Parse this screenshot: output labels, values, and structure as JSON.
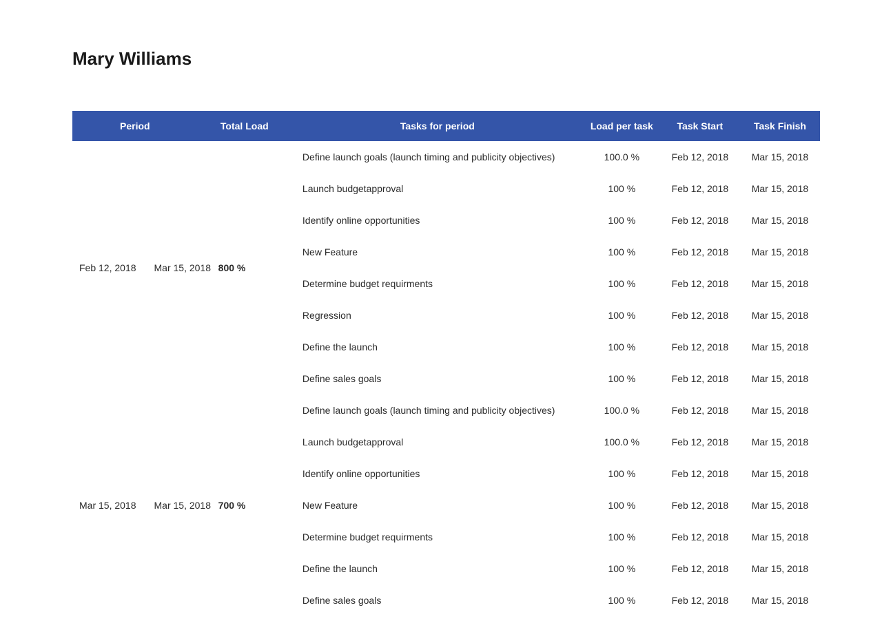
{
  "title": "Mary Williams",
  "headers": {
    "period": "Period",
    "total_load": "Total Load",
    "tasks": "Tasks for period",
    "load_per_task": "Load per task",
    "task_start": "Task Start",
    "task_finish": "Task Finish"
  },
  "periods": [
    {
      "start": "Feb 12, 2018",
      "end": "Mar 15, 2018",
      "total_load": "800 %",
      "tasks": [
        {
          "name": "Define launch goals (launch timing and publicity objectives)",
          "load": "100.0 %",
          "start": "Feb 12, 2018",
          "finish": "Mar 15, 2018"
        },
        {
          "name": "Launch budgetapproval",
          "load": "100 %",
          "start": "Feb 12, 2018",
          "finish": "Mar 15, 2018"
        },
        {
          "name": "Identify online opportunities",
          "load": "100 %",
          "start": "Feb 12, 2018",
          "finish": "Mar 15, 2018"
        },
        {
          "name": "New Feature",
          "load": "100 %",
          "start": "Feb 12, 2018",
          "finish": "Mar 15, 2018"
        },
        {
          "name": "Determine budget requirments",
          "load": "100 %",
          "start": "Feb 12, 2018",
          "finish": "Mar 15, 2018"
        },
        {
          "name": "Regression",
          "load": "100 %",
          "start": "Feb 12, 2018",
          "finish": "Mar 15, 2018"
        },
        {
          "name": "Define the launch",
          "load": "100 %",
          "start": "Feb 12, 2018",
          "finish": "Mar 15, 2018"
        },
        {
          "name": "Define sales goals",
          "load": "100 %",
          "start": "Feb 12, 2018",
          "finish": "Mar 15, 2018"
        }
      ]
    },
    {
      "start": "Mar 15, 2018",
      "end": "Mar 15, 2018",
      "total_load": "700 %",
      "tasks": [
        {
          "name": "Define launch goals (launch timing and publicity objectives)",
          "load": "100.0 %",
          "start": "Feb 12, 2018",
          "finish": "Mar 15, 2018"
        },
        {
          "name": "Launch budgetapproval",
          "load": "100.0 %",
          "start": "Feb 12, 2018",
          "finish": "Mar 15, 2018"
        },
        {
          "name": "Identify online opportunities",
          "load": "100 %",
          "start": "Feb 12, 2018",
          "finish": "Mar 15, 2018"
        },
        {
          "name": "New Feature",
          "load": "100 %",
          "start": "Feb 12, 2018",
          "finish": "Mar 15, 2018"
        },
        {
          "name": "Determine budget requirments",
          "load": "100 %",
          "start": "Feb 12, 2018",
          "finish": "Mar 15, 2018"
        },
        {
          "name": "Define the launch",
          "load": "100 %",
          "start": "Feb 12, 2018",
          "finish": "Mar 15, 2018"
        },
        {
          "name": "Define sales goals",
          "load": "100 %",
          "start": "Feb 12, 2018",
          "finish": "Mar 15, 2018"
        }
      ]
    }
  ]
}
